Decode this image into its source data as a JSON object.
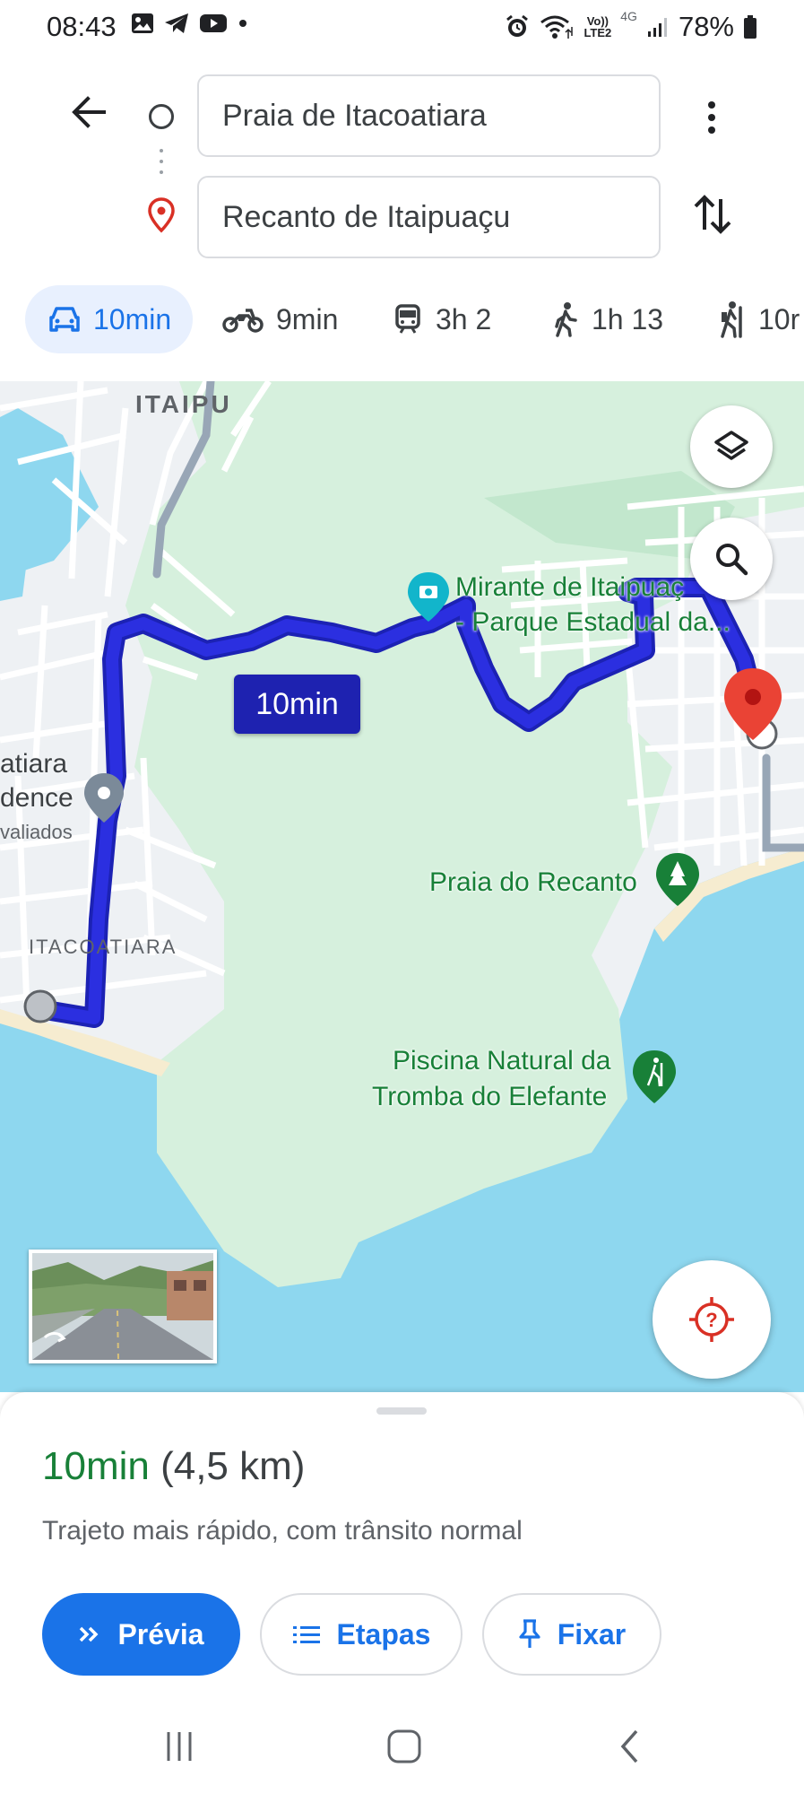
{
  "status_bar": {
    "time": "08:43",
    "battery_percent": "78%",
    "network_label_top": "Vo))",
    "network_label_bottom": "LTE2",
    "network_type": "4G",
    "icons": [
      "gallery-icon",
      "telegram-icon",
      "youtube-icon",
      "dot-icon",
      "alarm-icon",
      "wifi-icon",
      "signal-icon",
      "battery-icon"
    ]
  },
  "search": {
    "origin": "Praia de Itacoatiara",
    "destination": "Recanto de Itaipuaçu"
  },
  "travel_modes": [
    {
      "mode": "car",
      "label": "10min",
      "active": true
    },
    {
      "mode": "motorcycle",
      "label": "9min"
    },
    {
      "mode": "transit",
      "label": "3h 2"
    },
    {
      "mode": "walk",
      "label": "1h 13"
    },
    {
      "mode": "hike",
      "label": "10r"
    }
  ],
  "map": {
    "district_labels": [
      "ITAIPU",
      "ITACOATIARA"
    ],
    "route_time_chip": "10min",
    "pois": [
      {
        "name_line1": "Mirante de Itaipuaç",
        "name_line2": "- Parque Estadual da..."
      },
      {
        "name_line1": "Praia do Recanto"
      },
      {
        "name_line1": "Piscina Natural da",
        "name_line2": "Tromba do Elefante"
      }
    ],
    "partial_place": {
      "line1": "atiara",
      "line2": "dence",
      "line3": "valiados"
    },
    "colors": {
      "route": "#2b2fe0",
      "water": "#8ed7ef",
      "park": "#d6f0dd",
      "road": "#ffffff",
      "land": "#eef1f4",
      "beach": "#f6ecd0"
    }
  },
  "route_summary": {
    "duration": "10min",
    "distance": "(4,5 km)",
    "description": "Trajeto mais rápido, com trânsito normal"
  },
  "actions": {
    "preview": "Prévia",
    "steps": "Etapas",
    "pin": "Fixar"
  },
  "nav_bar": {
    "icons": [
      "recents-icon",
      "home-icon",
      "back-nav-icon"
    ]
  }
}
